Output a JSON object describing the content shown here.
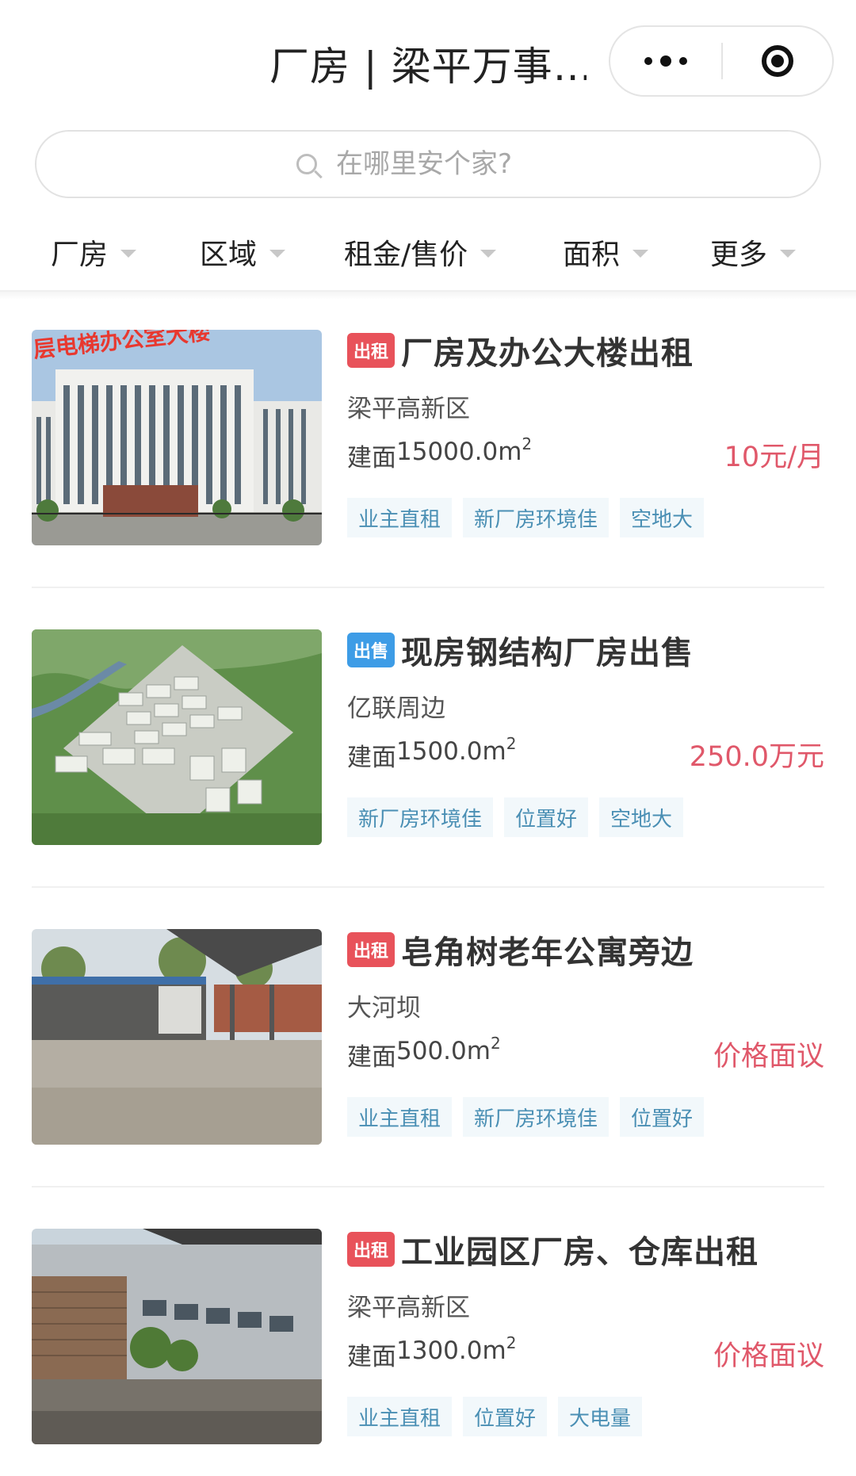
{
  "header": {
    "title": "厂房 | 梁平万事…"
  },
  "search": {
    "placeholder": "在哪里安个家?"
  },
  "filters": [
    {
      "label": "厂房"
    },
    {
      "label": "区域"
    },
    {
      "label": "租金/售价"
    },
    {
      "label": "面积"
    },
    {
      "label": "更多"
    }
  ],
  "listings": [
    {
      "badge": "出租",
      "badge_color": "#e8525a",
      "title": "厂房及办公大楼出租",
      "location": "梁平高新区",
      "area_prefix": "建面",
      "area_value": "15000.0",
      "area_unit": "m",
      "area_sup": "2",
      "price": "10元/月",
      "image_caption": "层电梯办公室大楼",
      "tags": [
        "业主直租",
        "新厂房环境佳",
        "空地大"
      ]
    },
    {
      "badge": "出售",
      "badge_color": "#3d9ce6",
      "title": "现房钢结构厂房出售",
      "location": "亿联周边",
      "area_prefix": "建面",
      "area_value": "1500.0",
      "area_unit": "m",
      "area_sup": "2",
      "price": "250.0万元",
      "tags": [
        "新厂房环境佳",
        "位置好",
        "空地大"
      ]
    },
    {
      "badge": "出租",
      "badge_color": "#e8525a",
      "title": "皂角树老年公寓旁边",
      "location": "大河坝",
      "area_prefix": "建面",
      "area_value": "500.0",
      "area_unit": "m",
      "area_sup": "2",
      "price": "价格面议",
      "tags": [
        "业主直租",
        "新厂房环境佳",
        "位置好"
      ]
    },
    {
      "badge": "出租",
      "badge_color": "#e8525a",
      "title": "工业园区厂房、仓库出租",
      "location": "梁平高新区",
      "area_prefix": "建面",
      "area_value": "1300.0",
      "area_unit": "m",
      "area_sup": "2",
      "price": "价格面议",
      "tags": [
        "业主直租",
        "位置好",
        "大电量"
      ]
    }
  ]
}
